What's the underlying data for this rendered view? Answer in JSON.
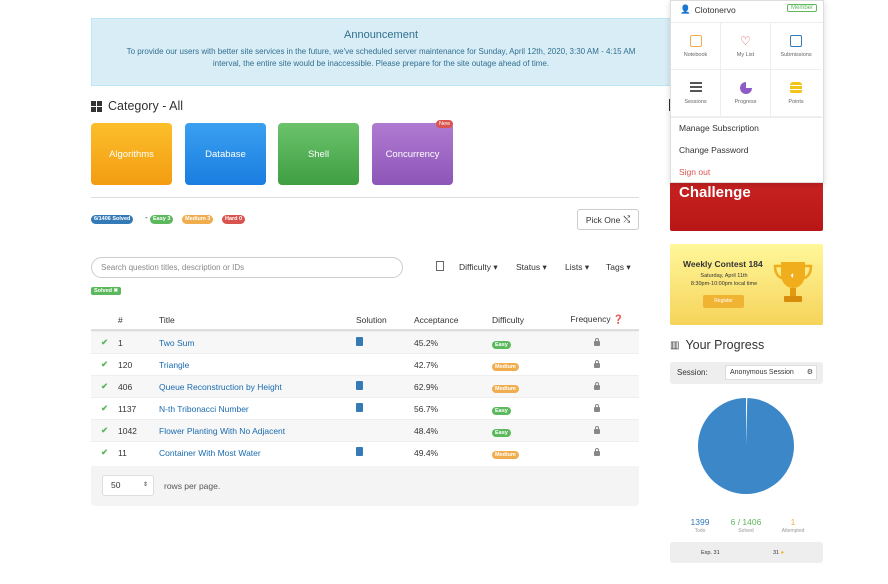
{
  "announcement": {
    "title": "Announcement",
    "message": "To provide our users with better site services in the future, we've scheduled server maintenance for Sunday, April 12th, 2020, 3:30 AM - 4:15 AM interval, the entire site would be inaccessible. Please prepare for the site outage ahead of time."
  },
  "category": {
    "title": "Category - All",
    "cards": [
      "Algorithms",
      "Database",
      "Shell",
      "Concurrency"
    ],
    "new_badge": "New"
  },
  "stats": {
    "solved": "6/1406 Solved",
    "dash": "-",
    "easy": "Easy 3",
    "medium": "Medium 3",
    "hard": "Hard 0"
  },
  "pick_one": "Pick One",
  "search": {
    "placeholder": "Search question titles, description or IDs"
  },
  "filters": {
    "difficulty": "Difficulty ▾",
    "status": "Status ▾",
    "lists": "Lists ▾",
    "tags": "Tags ▾"
  },
  "solved_chip": "Solved ✖",
  "table": {
    "headers": {
      "num": "#",
      "title": "Title",
      "solution": "Solution",
      "acceptance": "Acceptance",
      "difficulty": "Difficulty",
      "frequency": "Frequency"
    },
    "rows": [
      {
        "num": "1",
        "title": "Two Sum",
        "acc": "45.2%",
        "diff": "Easy",
        "sol": true
      },
      {
        "num": "120",
        "title": "Triangle",
        "acc": "42.7%",
        "diff": "Medium",
        "sol": false
      },
      {
        "num": "406",
        "title": "Queue Reconstruction by Height",
        "acc": "62.9%",
        "diff": "Medium",
        "sol": true
      },
      {
        "num": "1137",
        "title": "N-th Tribonacci Number",
        "acc": "56.7%",
        "diff": "Easy",
        "sol": true
      },
      {
        "num": "1042",
        "title": "Flower Planting With No Adjacent",
        "acc": "48.4%",
        "diff": "Easy",
        "sol": false
      },
      {
        "num": "11",
        "title": "Container With Most Water",
        "acc": "49.4%",
        "diff": "Medium",
        "sol": true
      }
    ]
  },
  "pager": {
    "rows": "50",
    "label": "rows per page."
  },
  "challenge": "Challenge",
  "contest": {
    "title": "Weekly Contest 184",
    "date": "Saturday, April 11th\n8:30pm-10:00pm local time",
    "register": "Register"
  },
  "progress": {
    "title": "Your Progress",
    "session_label": "Session:",
    "session_value": "Anonymous Session",
    "todo": "1399",
    "todo_lbl": "Todo",
    "solved": "6 / 1406",
    "solved_lbl": "Solved",
    "attempted": "1",
    "attempted_lbl": "Attempted",
    "exp": "Exp. 31",
    "coins": "31",
    "solved_fraction": 0.0043
  },
  "dropdown": {
    "user": "Clotonervo",
    "badge": "Member",
    "cells": [
      "Notebook",
      "My List",
      "Submissions",
      "Sessions",
      "Progress",
      "Points"
    ],
    "manage": "Manage Subscription",
    "change": "Change Password",
    "signout": "Sign out"
  },
  "colors": {
    "accent": "#337ab7",
    "easy": "#5cb85c",
    "medium": "#f0ad4e",
    "hard": "#d9534f"
  }
}
